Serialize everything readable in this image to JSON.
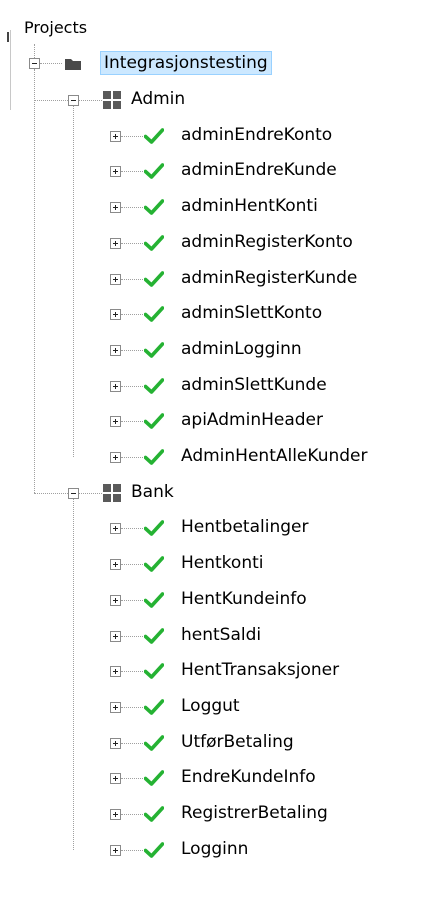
{
  "tree": {
    "root_label": "Projects",
    "project": {
      "label": "Integrasjonstesting",
      "icon": "folder-icon"
    },
    "groups": [
      {
        "label": "Admin",
        "icon": "grid-icon",
        "items": [
          "adminEndreKonto",
          "adminEndreKunde",
          "adminHentKonti",
          "adminRegisterKonto",
          "adminRegisterKunde",
          "adminSlettKonto",
          "adminLogginn",
          "adminSlettKunde",
          "apiAdminHeader",
          "AdminHentAlleKunder"
        ]
      },
      {
        "label": "Bank",
        "icon": "grid-icon",
        "items": [
          "Hentbetalinger",
          "Hentkonti",
          "HentKundeinfo",
          "hentSaldi",
          "HentTransaksjoner",
          "Loggut",
          "UtførBetaling",
          "EndreKundeInfo",
          "RegistrerBetaling",
          "Logginn"
        ]
      }
    ],
    "item_icon": "check-icon"
  },
  "colors": {
    "check": "#25b233",
    "folder": "#4a4a4a",
    "grid": "#5a5a5a",
    "selection_bg": "#cce8ff",
    "selection_border": "#99d1ff"
  }
}
